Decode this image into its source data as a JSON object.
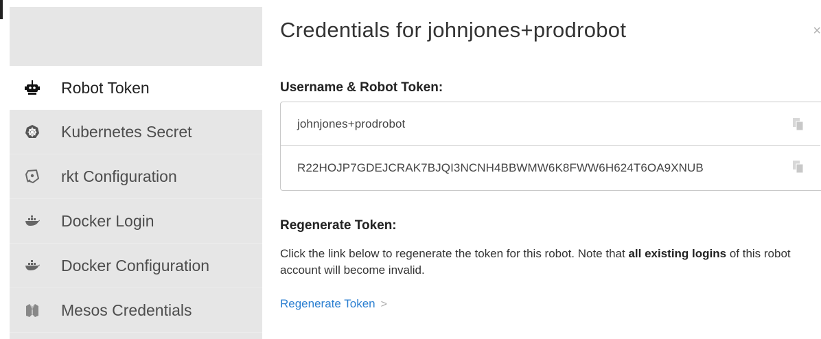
{
  "sidebar": {
    "items": [
      {
        "label": "Robot Token",
        "icon": "robot-icon",
        "active": true
      },
      {
        "label": "Kubernetes Secret",
        "icon": "kubernetes-icon",
        "active": false
      },
      {
        "label": "rkt Configuration",
        "icon": "rkt-icon",
        "active": false
      },
      {
        "label": "Docker Login",
        "icon": "docker-icon",
        "active": false
      },
      {
        "label": "Docker Configuration",
        "icon": "docker-icon",
        "active": false
      },
      {
        "label": "Mesos Credentials",
        "icon": "mesos-icon",
        "active": false
      }
    ]
  },
  "main": {
    "title": "Credentials for johnjones+prodrobot",
    "close_glyph": "×",
    "credentials_heading": "Username & Robot Token:",
    "username": "johnjones+prodrobot",
    "token": "R22HOJP7GDEJCRAK7BJQI3NCNH4BBWMW6K8FWW6H624T6OA9XNUB",
    "regenerate_heading": "Regenerate Token:",
    "regenerate_desc_prefix": "Click the link below to regenerate the token for this robot. Note that ",
    "regenerate_desc_bold": "all existing logins",
    "regenerate_desc_suffix": " of this robot account will become invalid.",
    "regenerate_link": "Regenerate Token",
    "regenerate_chevron": ">"
  },
  "colors": {
    "link": "#2b7fd1",
    "sidebar_bg": "#e6e6e6",
    "active_item_bg": "#ffffff"
  }
}
